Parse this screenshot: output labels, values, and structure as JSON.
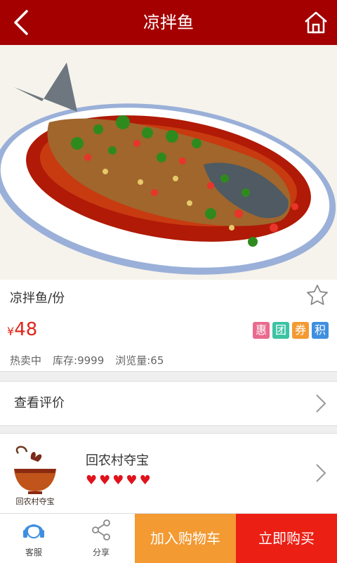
{
  "header": {
    "title": "凉拌鱼",
    "back_icon": "back-arrow-icon",
    "home_icon": "home-icon"
  },
  "product": {
    "name": "凉拌鱼/份",
    "currency": "¥",
    "price": "48",
    "tags": [
      {
        "label": "惠",
        "color": "#e96a8d"
      },
      {
        "label": "团",
        "color": "#3cc3a3"
      },
      {
        "label": "券",
        "color": "#f39a32"
      },
      {
        "label": "积",
        "color": "#3f8fe0"
      }
    ],
    "stats": {
      "status": "热卖中",
      "stock": "库存:9999",
      "views": "浏览量:65"
    }
  },
  "review": {
    "label": "查看评价"
  },
  "shop": {
    "name": "回农村夺宝",
    "logo_text": "回农村夺宝",
    "hearts": 5
  },
  "bottom": {
    "service_label": "客服",
    "share_label": "分享",
    "cart_label": "加入购物车",
    "buy_label": "立即购买"
  },
  "colors": {
    "header": "#a40000",
    "price": "#e0261b",
    "cart": "#f39a32",
    "buy": "#ec1f15"
  }
}
